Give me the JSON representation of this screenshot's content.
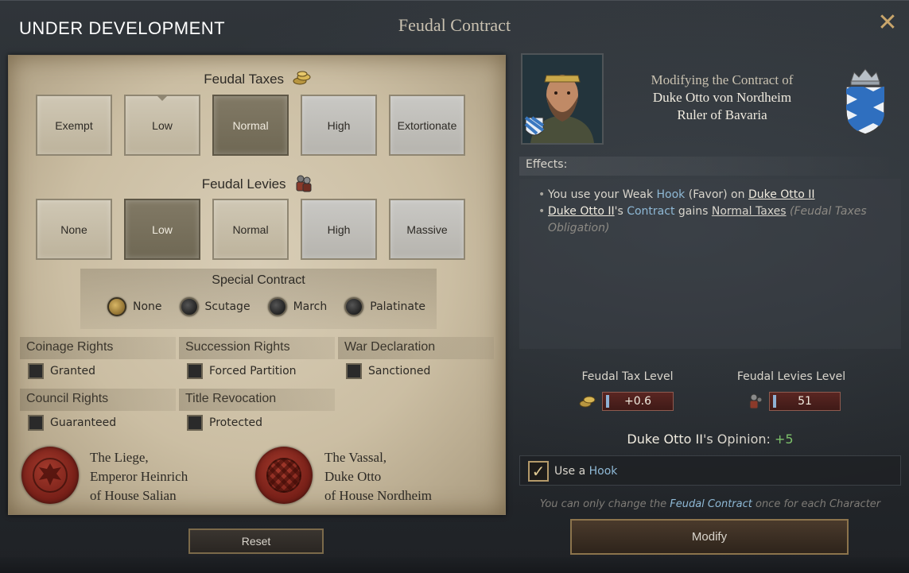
{
  "window": {
    "dev_label": "UNDER DEVELOPMENT",
    "title": "Feudal Contract",
    "close_glyph": "✕"
  },
  "taxes": {
    "title": "Feudal Taxes",
    "icon": "gold-coins-icon",
    "options": [
      "Exempt",
      "Low",
      "Normal",
      "High",
      "Extortionate"
    ],
    "selected": "Normal",
    "current": "Low"
  },
  "levies": {
    "title": "Feudal Levies",
    "icon": "soldiers-icon",
    "options": [
      "None",
      "Low",
      "Normal",
      "High",
      "Massive"
    ],
    "selected": "Low"
  },
  "special": {
    "title": "Special Contract",
    "options": [
      "None",
      "Scutage",
      "March",
      "Palatinate"
    ],
    "selected": "None"
  },
  "rights": {
    "coinage": {
      "title": "Coinage Rights",
      "item": "Granted",
      "checked": false
    },
    "succession": {
      "title": "Succession Rights",
      "item": "Forced Partition",
      "checked": false
    },
    "war": {
      "title": "War Declaration",
      "item": "Sanctioned",
      "checked": false
    },
    "council": {
      "title": "Council Rights",
      "item": "Guaranteed",
      "checked": false
    },
    "revocation": {
      "title": "Title Revocation",
      "item": "Protected",
      "checked": false
    }
  },
  "signatures": {
    "liege": [
      "The Liege,",
      "Emperor Heinrich",
      "of House Salian"
    ],
    "vassal": [
      "The Vassal,",
      "Duke Otto",
      "of House Nordheim"
    ]
  },
  "buttons": {
    "reset": "Reset",
    "modify": "Modify"
  },
  "target": {
    "line1": "Modifying the Contract of",
    "line2": "Duke Otto von Nordheim",
    "line3": "Ruler of Bavaria"
  },
  "effects": {
    "label": "Effects:",
    "line1": {
      "prefix": "You use your Weak ",
      "hook": "Hook",
      "mid": " (Favor) on ",
      "target": "Duke Otto II"
    },
    "line2": {
      "target": "Duke Otto II",
      "poss": "'s ",
      "contract": "Contract",
      "gains": " gains ",
      "obligation": "Normal Taxes",
      "note": "(Feudal Taxes Obligation)"
    }
  },
  "levels": {
    "tax_label": "Feudal Tax Level",
    "tax_value": "+0.6",
    "levies_label": "Feudal Levies Level",
    "levies_value": "51"
  },
  "opinion": {
    "name": "Duke Otto II",
    "label": "'s Opinion: ",
    "value": "+5"
  },
  "hook": {
    "checked": true,
    "prefix": "Use a ",
    "word": "Hook"
  },
  "note": {
    "prefix": "You can only change the ",
    "link": "Feudal Contract",
    "suffix": " once for each Character"
  },
  "colors": {
    "parchment": "#cbbea3",
    "selected_option": "#6f6854",
    "accent_gold": "#c9a66b",
    "positive": "#7cc06a",
    "link_blue": "#8fb9d6"
  }
}
